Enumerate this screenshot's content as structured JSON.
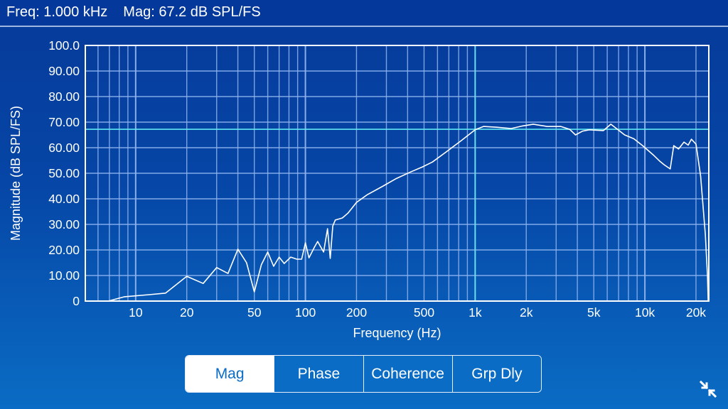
{
  "readout": {
    "freq_text": "Freq: 1.000 kHz",
    "mag_text": "Mag: 67.2 dB SPL/FS"
  },
  "tabs": [
    {
      "label": "Mag",
      "active": true
    },
    {
      "label": "Phase",
      "active": false
    },
    {
      "label": "Coherence",
      "active": false
    },
    {
      "label": "Grp Dly",
      "active": false
    }
  ],
  "icons": {
    "collapse": "collapse-arrows-icon"
  },
  "colors": {
    "background_top": "#063a9a",
    "background_bottom": "#0a6cc4",
    "grid": "#8fb4ee",
    "trace": "#ffffff",
    "cursor": "#5fe6f0"
  },
  "chart_data": {
    "type": "line",
    "title": "",
    "xlabel": "Frequency (Hz)",
    "ylabel": "Magnitude (dB SPL/FS)",
    "xscale": "log",
    "xlim": [
      5.05,
      23800
    ],
    "ylim": [
      0,
      100
    ],
    "grid": true,
    "x_tick_values": [
      10,
      20,
      50,
      100,
      200,
      500,
      1000,
      2000,
      5000,
      10000,
      20000
    ],
    "x_tick_labels": [
      "10",
      "20",
      "50",
      "100",
      "200",
      "500",
      "1k",
      "2k",
      "5k",
      "10k",
      "20k"
    ],
    "y_tick_values": [
      0,
      10,
      20,
      30,
      40,
      50,
      60,
      70,
      80,
      90,
      100
    ],
    "y_tick_labels": [
      "0",
      "10.00",
      "20.00",
      "30.00",
      "40.00",
      "50.00",
      "60.00",
      "70.00",
      "80.00",
      "90.00",
      "100.0"
    ],
    "cursor": {
      "x": 1000,
      "y": 67.2
    },
    "series": [
      {
        "name": "Magnitude",
        "x": [
          6.9,
          8.6,
          12,
          15,
          20,
          25,
          30,
          35,
          40,
          45,
          50,
          55,
          60,
          65,
          70,
          75,
          82,
          89,
          95,
          100,
          105,
          113,
          118,
          128,
          135,
          140,
          145,
          150,
          165,
          178,
          200,
          230,
          287,
          340,
          420,
          490,
          560,
          680,
          830,
          1000,
          1120,
          1340,
          1630,
          1900,
          2200,
          2650,
          3200,
          3600,
          3900,
          4300,
          4700,
          5700,
          6300,
          6800,
          7600,
          8600,
          9700,
          11200,
          12200,
          13000,
          14100,
          14800,
          15800,
          17000,
          18000,
          18800,
          20000,
          21300,
          22700,
          23400,
          23600
        ],
        "y": [
          0,
          1.7,
          2.5,
          3.1,
          9.7,
          6.9,
          13.1,
          10.8,
          20.3,
          15,
          3.6,
          14.2,
          19.2,
          13.6,
          17.2,
          14.7,
          17.2,
          16.4,
          16.4,
          22.8,
          16.9,
          21.1,
          23.3,
          19.2,
          28.3,
          16.7,
          29.4,
          31.7,
          32.5,
          34.4,
          38.6,
          41.5,
          45,
          47.8,
          50.6,
          52.5,
          54.4,
          58.5,
          62.8,
          67,
          68.3,
          68,
          67.5,
          68.5,
          69.2,
          68.3,
          68.3,
          67.2,
          65,
          66.5,
          67,
          66.7,
          69.2,
          67.5,
          65,
          63.5,
          60.8,
          57.2,
          54.8,
          53.3,
          51.7,
          60.8,
          59.5,
          62.2,
          61,
          63.3,
          61.4,
          48.9,
          26.1,
          9.4,
          0
        ]
      }
    ]
  }
}
